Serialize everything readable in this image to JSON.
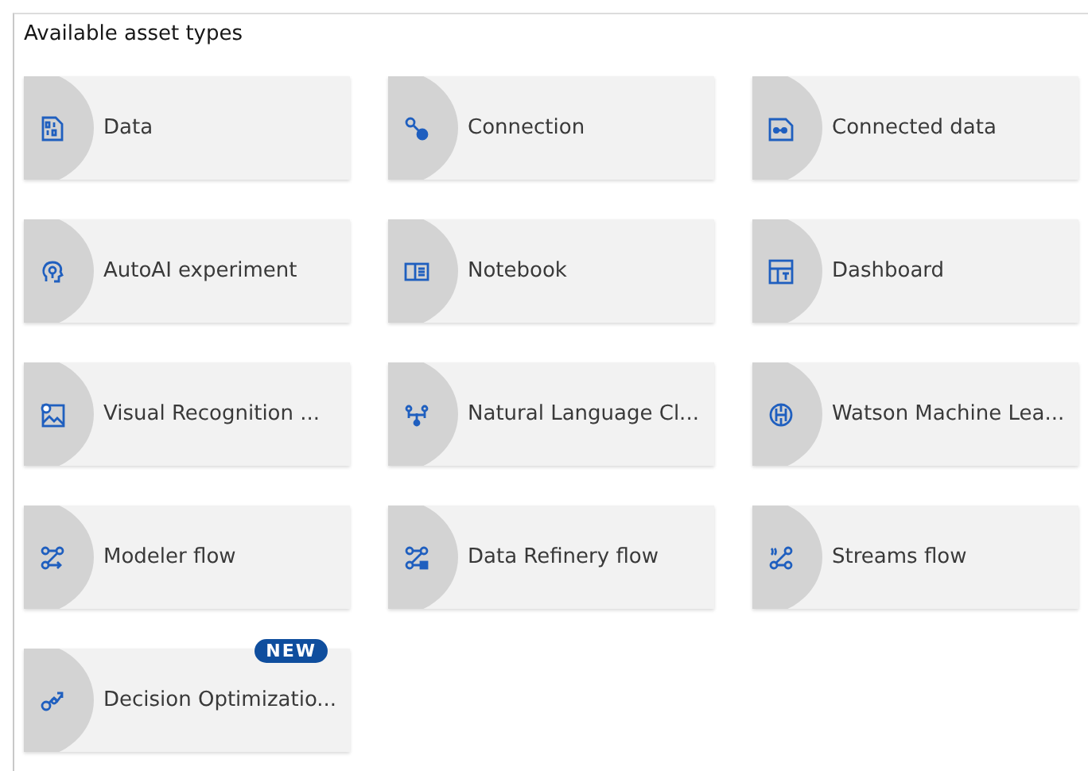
{
  "heading": "Available asset types",
  "assets": [
    {
      "label": "Data"
    },
    {
      "label": "Connection"
    },
    {
      "label": "Connected data"
    },
    {
      "label": "AutoAI experiment"
    },
    {
      "label": "Notebook"
    },
    {
      "label": "Dashboard"
    },
    {
      "label": "Visual Recognition ..."
    },
    {
      "label": "Natural Language Cl..."
    },
    {
      "label": "Watson Machine Lea..."
    },
    {
      "label": "Modeler flow"
    },
    {
      "label": "Data Refinery flow"
    },
    {
      "label": "Streams flow"
    },
    {
      "label": "Decision Optimizatio...",
      "badge": "NEW"
    }
  ]
}
